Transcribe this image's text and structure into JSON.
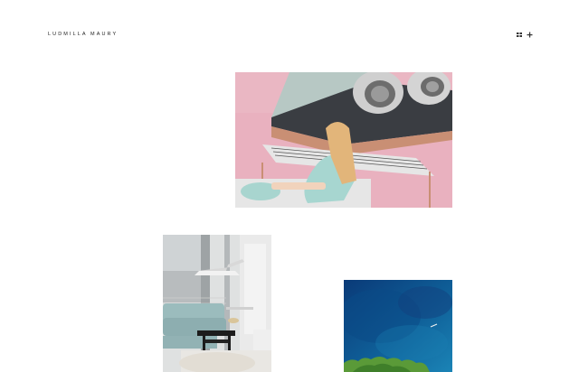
{
  "header": {
    "brand": "LUDMILLA MAURY",
    "icons": [
      "grid-icon",
      "plus-icon"
    ]
  },
  "gallery": {
    "items": [
      {
        "name": "piano-girl-artwork",
        "palette": {
          "background": "#e8aebd",
          "copper": "#c99074",
          "shirt": "#a7d6d0",
          "hair": "#e2b57a"
        }
      },
      {
        "name": "living-room-photo",
        "palette": {
          "wall": "#dfe1e1",
          "sofa": "#9bbcbd",
          "lamp": "#efefef",
          "table": "#1c1c1c"
        }
      },
      {
        "name": "ocean-aerial-photo",
        "palette": {
          "water": "#0d5e95",
          "deep": "#0a3a78",
          "trees": "#5a9a38"
        }
      }
    ]
  }
}
